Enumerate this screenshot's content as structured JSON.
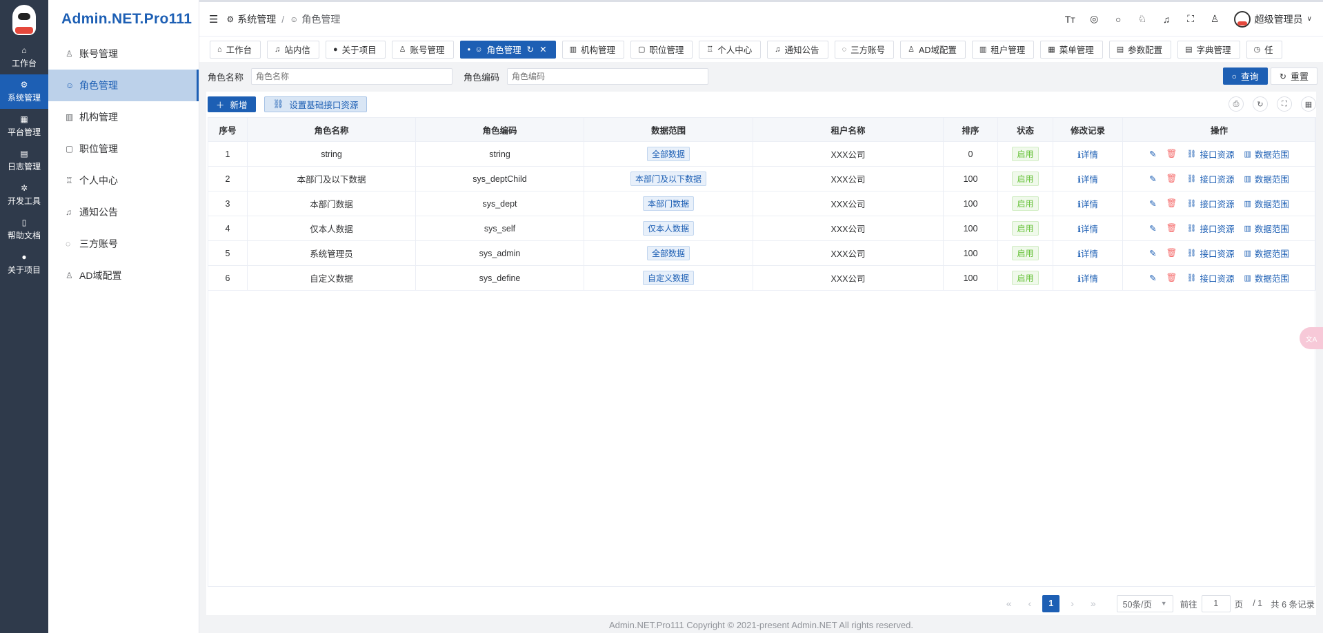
{
  "rail": {
    "items": [
      {
        "icon": "home-icon",
        "glyph": "⌂",
        "label": "工作台"
      },
      {
        "icon": "gear-icon",
        "glyph": "⚙",
        "label": "系统管理"
      },
      {
        "icon": "grid-icon",
        "glyph": "▦",
        "label": "平台管理"
      },
      {
        "icon": "log-icon",
        "glyph": "▤",
        "label": "日志管理"
      },
      {
        "icon": "tool-icon",
        "glyph": "✲",
        "label": "开发工具"
      },
      {
        "icon": "doc-icon",
        "glyph": "▯",
        "label": "帮助文档"
      },
      {
        "icon": "info-icon",
        "glyph": "●",
        "label": "关于项目"
      }
    ]
  },
  "submenu": {
    "brand": "Admin.NET.Pro111",
    "items": [
      {
        "icon": "user-icon",
        "glyph": "♙",
        "label": "账号管理"
      },
      {
        "icon": "role-icon",
        "glyph": "☺",
        "label": "角色管理"
      },
      {
        "icon": "org-icon",
        "glyph": "▥",
        "label": "机构管理"
      },
      {
        "icon": "position-icon",
        "glyph": "▢",
        "label": "职位管理"
      },
      {
        "icon": "personal-icon",
        "glyph": "♖",
        "label": "个人中心"
      },
      {
        "icon": "bell-icon",
        "glyph": "♫",
        "label": "通知公告"
      },
      {
        "icon": "chat-icon",
        "glyph": "◌",
        "label": "三方账号"
      },
      {
        "icon": "ad-icon",
        "glyph": "♙",
        "label": "AD域配置"
      }
    ]
  },
  "header": {
    "breadcrumb": [
      "系统管理",
      "/",
      "角色管理"
    ],
    "user": "超级管理员"
  },
  "tabs": [
    {
      "icon": "⌂",
      "label": "工作台"
    },
    {
      "icon": "♫",
      "label": "站内信"
    },
    {
      "icon": "●",
      "label": "关于项目"
    },
    {
      "icon": "♙",
      "label": "账号管理"
    },
    {
      "icon": "☺",
      "label": "角色管理"
    },
    {
      "icon": "▥",
      "label": "机构管理"
    },
    {
      "icon": "▢",
      "label": "职位管理"
    },
    {
      "icon": "♖",
      "label": "个人中心"
    },
    {
      "icon": "♫",
      "label": "通知公告"
    },
    {
      "icon": "◌",
      "label": "三方账号"
    },
    {
      "icon": "♙",
      "label": "AD域配置"
    },
    {
      "icon": "▥",
      "label": "租户管理"
    },
    {
      "icon": "▦",
      "label": "菜单管理"
    },
    {
      "icon": "▤",
      "label": "参数配置"
    },
    {
      "icon": "▤",
      "label": "字典管理"
    },
    {
      "icon": "◷",
      "label": "任"
    }
  ],
  "search": {
    "role_name_label": "角色名称",
    "role_name_placeholder": "角色名称",
    "role_code_label": "角色编码",
    "role_code_placeholder": "角色编码",
    "query_label": "查询",
    "reset_label": "重置"
  },
  "toolbar": {
    "add_label": "新增",
    "base_api_label": "设置基础接口资源"
  },
  "table": {
    "columns": [
      "序号",
      "角色名称",
      "角色编码",
      "数据范围",
      "租户名称",
      "排序",
      "状态",
      "修改记录",
      "操作"
    ],
    "rows": [
      {
        "index": "1",
        "name": "string",
        "code": "string",
        "scope": "全部数据",
        "tenant": "XXX公司",
        "order": "0",
        "status": "启用"
      },
      {
        "index": "2",
        "name": "本部门及以下数据",
        "code": "sys_deptChild",
        "scope": "本部门及以下数据",
        "tenant": "XXX公司",
        "order": "100",
        "status": "启用"
      },
      {
        "index": "3",
        "name": "本部门数据",
        "code": "sys_dept",
        "scope": "本部门数据",
        "tenant": "XXX公司",
        "order": "100",
        "status": "启用"
      },
      {
        "index": "4",
        "name": "仅本人数据",
        "code": "sys_self",
        "scope": "仅本人数据",
        "tenant": "XXX公司",
        "order": "100",
        "status": "启用"
      },
      {
        "index": "5",
        "name": "系统管理员",
        "code": "sys_admin",
        "scope": "全部数据",
        "tenant": "XXX公司",
        "order": "100",
        "status": "启用"
      },
      {
        "index": "6",
        "name": "自定义数据",
        "code": "sys_define",
        "scope": "自定义数据",
        "tenant": "XXX公司",
        "order": "100",
        "status": "启用"
      }
    ],
    "detail_label": "详情",
    "api_label": "接口资源",
    "scope_label": "数据范围"
  },
  "pagination": {
    "current": "1",
    "page_size": "50条/页",
    "goto_label": "前往",
    "goto_value": "1",
    "page_suffix": "页",
    "total_pages": "/ 1",
    "total": "共 6 条记录"
  },
  "footer": "Admin.NET.Pro111 Copyright © 2021-present Admin.NET All rights reserved.",
  "colors": {
    "primary": "#1d5fb4",
    "rail_bg": "#2f3a4b",
    "danger": "#f56c6c",
    "success": "#67c23a"
  }
}
